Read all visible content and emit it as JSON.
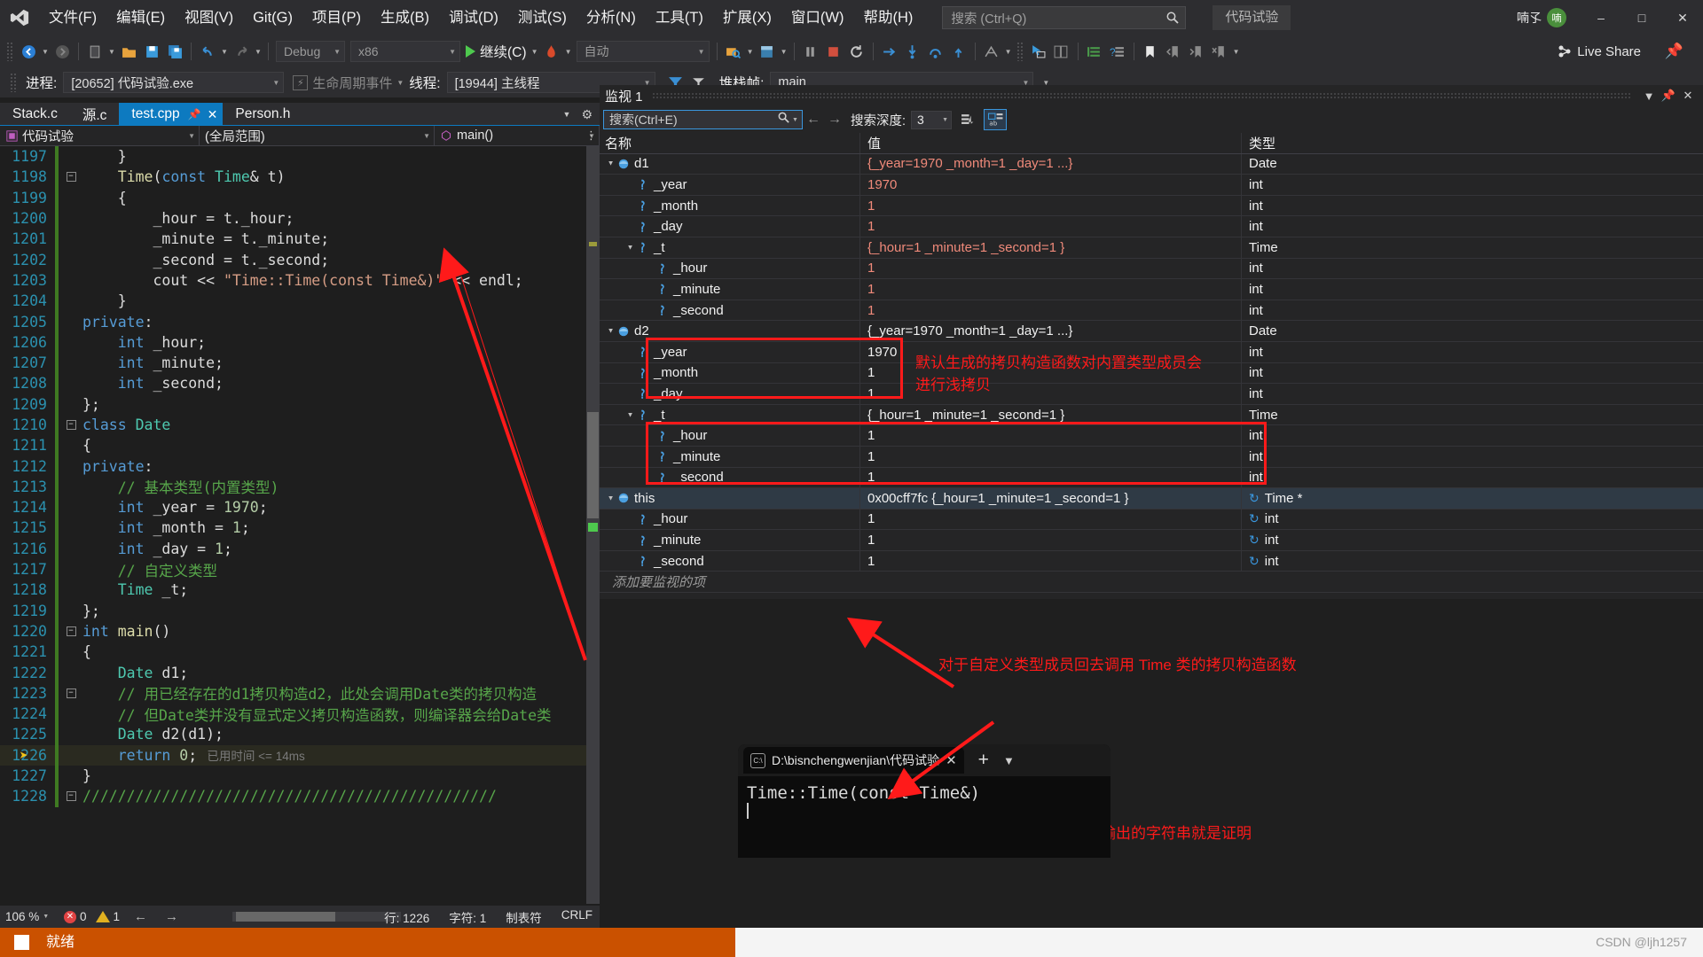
{
  "menu": {
    "items": [
      "文件(F)",
      "编辑(E)",
      "视图(V)",
      "Git(G)",
      "项目(P)",
      "生成(B)",
      "调试(D)",
      "测试(S)",
      "分析(N)",
      "工具(T)",
      "扩展(X)",
      "窗口(W)",
      "帮助(H)"
    ],
    "search_placeholder": "搜索 (Ctrl+Q)",
    "project_chip": "代码试验",
    "account_name": "喃孓",
    "account_initial": "喃"
  },
  "toolbar": {
    "config": "Debug",
    "platform": "x86",
    "run_label": "继续(C)",
    "auto": "自动",
    "live_share": "Live Share"
  },
  "debugbar": {
    "process_label": "进程:",
    "process_value": "[20652] 代码试验.exe",
    "lifecycle": "生命周期事件",
    "thread_label": "线程:",
    "thread_value": "[19944] 主线程",
    "stackframe_label": "堆栈帧:",
    "stackframe_value": "main"
  },
  "editor": {
    "tabs": [
      {
        "label": "Stack.c",
        "active": false
      },
      {
        "label": "源.c",
        "active": false
      },
      {
        "label": "test.cpp",
        "active": true
      },
      {
        "label": "Person.h",
        "active": false
      }
    ],
    "nav": {
      "project": "代码试验",
      "scope": "(全局范围)",
      "member": "main()"
    },
    "lines": [
      {
        "n": "1197",
        "fold": "",
        "cur": false,
        "tokens": [
          {
            "t": "    }",
            "c": "c-pun"
          }
        ]
      },
      {
        "n": "1198",
        "fold": "-",
        "cur": false,
        "tokens": [
          {
            "t": "    ",
            "c": "c-pun"
          },
          {
            "t": "Time",
            "c": "c-fn"
          },
          {
            "t": "(",
            "c": "c-pun"
          },
          {
            "t": "const",
            "c": "c-kw"
          },
          {
            "t": " ",
            "c": "c-pun"
          },
          {
            "t": "Time",
            "c": "c-type"
          },
          {
            "t": "& t)",
            "c": "c-pun"
          }
        ]
      },
      {
        "n": "1199",
        "fold": "",
        "cur": false,
        "tokens": [
          {
            "t": "    {",
            "c": "c-pun"
          }
        ]
      },
      {
        "n": "1200",
        "fold": "",
        "cur": false,
        "tokens": [
          {
            "t": "        _hour = t._hour;",
            "c": "c-pun"
          }
        ]
      },
      {
        "n": "1201",
        "fold": "",
        "cur": false,
        "tokens": [
          {
            "t": "        _minute = t._minute;",
            "c": "c-pun"
          }
        ]
      },
      {
        "n": "1202",
        "fold": "",
        "cur": false,
        "tokens": [
          {
            "t": "        _second = t._second;",
            "c": "c-pun"
          }
        ]
      },
      {
        "n": "1203",
        "fold": "",
        "cur": false,
        "tokens": [
          {
            "t": "        cout << ",
            "c": "c-pun"
          },
          {
            "t": "\"Time::Time(const Time&)\"",
            "c": "c-str"
          },
          {
            "t": " << endl;",
            "c": "c-pun"
          }
        ]
      },
      {
        "n": "1204",
        "fold": "",
        "cur": false,
        "tokens": [
          {
            "t": "    }",
            "c": "c-pun"
          }
        ]
      },
      {
        "n": "1205",
        "fold": "",
        "cur": false,
        "tokens": [
          {
            "t": "private",
            "c": "c-kw"
          },
          {
            "t": ":",
            "c": "c-pun"
          }
        ]
      },
      {
        "n": "1206",
        "fold": "",
        "cur": false,
        "tokens": [
          {
            "t": "    ",
            "c": "c-pun"
          },
          {
            "t": "int",
            "c": "c-kw"
          },
          {
            "t": " _hour;",
            "c": "c-pun"
          }
        ]
      },
      {
        "n": "1207",
        "fold": "",
        "cur": false,
        "tokens": [
          {
            "t": "    ",
            "c": "c-pun"
          },
          {
            "t": "int",
            "c": "c-kw"
          },
          {
            "t": " _minute;",
            "c": "c-pun"
          }
        ]
      },
      {
        "n": "1208",
        "fold": "",
        "cur": false,
        "tokens": [
          {
            "t": "    ",
            "c": "c-pun"
          },
          {
            "t": "int",
            "c": "c-kw"
          },
          {
            "t": " _second;",
            "c": "c-pun"
          }
        ]
      },
      {
        "n": "1209",
        "fold": "",
        "cur": false,
        "tokens": [
          {
            "t": "};",
            "c": "c-pun"
          }
        ]
      },
      {
        "n": "1210",
        "fold": "-",
        "cur": false,
        "tokens": [
          {
            "t": "class",
            "c": "c-kw"
          },
          {
            "t": " ",
            "c": "c-pun"
          },
          {
            "t": "Date",
            "c": "c-type"
          }
        ]
      },
      {
        "n": "1211",
        "fold": "",
        "cur": false,
        "tokens": [
          {
            "t": "{",
            "c": "c-pun"
          }
        ]
      },
      {
        "n": "1212",
        "fold": "",
        "cur": false,
        "tokens": [
          {
            "t": "private",
            "c": "c-kw"
          },
          {
            "t": ":",
            "c": "c-pun"
          }
        ]
      },
      {
        "n": "1213",
        "fold": "",
        "cur": false,
        "tokens": [
          {
            "t": "    // 基本类型(内置类型)",
            "c": "c-com"
          }
        ]
      },
      {
        "n": "1214",
        "fold": "",
        "cur": false,
        "tokens": [
          {
            "t": "    ",
            "c": "c-pun"
          },
          {
            "t": "int",
            "c": "c-kw"
          },
          {
            "t": " _year = ",
            "c": "c-pun"
          },
          {
            "t": "1970",
            "c": "c-num"
          },
          {
            "t": ";",
            "c": "c-pun"
          }
        ]
      },
      {
        "n": "1215",
        "fold": "",
        "cur": false,
        "tokens": [
          {
            "t": "    ",
            "c": "c-pun"
          },
          {
            "t": "int",
            "c": "c-kw"
          },
          {
            "t": " _month = ",
            "c": "c-pun"
          },
          {
            "t": "1",
            "c": "c-num"
          },
          {
            "t": ";",
            "c": "c-pun"
          }
        ]
      },
      {
        "n": "1216",
        "fold": "",
        "cur": false,
        "tokens": [
          {
            "t": "    ",
            "c": "c-pun"
          },
          {
            "t": "int",
            "c": "c-kw"
          },
          {
            "t": " _day = ",
            "c": "c-pun"
          },
          {
            "t": "1",
            "c": "c-num"
          },
          {
            "t": ";",
            "c": "c-pun"
          }
        ]
      },
      {
        "n": "1217",
        "fold": "",
        "cur": false,
        "tokens": [
          {
            "t": "    // 自定义类型",
            "c": "c-com"
          }
        ]
      },
      {
        "n": "1218",
        "fold": "",
        "cur": false,
        "tokens": [
          {
            "t": "    ",
            "c": "c-pun"
          },
          {
            "t": "Time",
            "c": "c-type"
          },
          {
            "t": " _t;",
            "c": "c-pun"
          }
        ]
      },
      {
        "n": "1219",
        "fold": "",
        "cur": false,
        "tokens": [
          {
            "t": "};",
            "c": "c-pun"
          }
        ]
      },
      {
        "n": "1220",
        "fold": "-",
        "cur": false,
        "tokens": [
          {
            "t": "int",
            "c": "c-kw"
          },
          {
            "t": " ",
            "c": "c-pun"
          },
          {
            "t": "main",
            "c": "c-fn"
          },
          {
            "t": "()",
            "c": "c-pun"
          }
        ]
      },
      {
        "n": "1221",
        "fold": "",
        "cur": false,
        "tokens": [
          {
            "t": "{",
            "c": "c-pun"
          }
        ]
      },
      {
        "n": "1222",
        "fold": "",
        "cur": false,
        "tokens": [
          {
            "t": "    ",
            "c": "c-pun"
          },
          {
            "t": "Date",
            "c": "c-type"
          },
          {
            "t": " d1;",
            "c": "c-pun"
          }
        ]
      },
      {
        "n": "1223",
        "fold": "-",
        "cur": false,
        "tokens": [
          {
            "t": "    // 用已经存在的d1拷贝构造d2，此处会调用Date类的拷贝构造",
            "c": "c-com"
          }
        ]
      },
      {
        "n": "1224",
        "fold": "",
        "cur": false,
        "tokens": [
          {
            "t": "    // 但Date类并没有显式定义拷贝构造函数，则编译器会给Date类",
            "c": "c-com"
          }
        ]
      },
      {
        "n": "1225",
        "fold": "",
        "cur": false,
        "tokens": [
          {
            "t": "    ",
            "c": "c-pun"
          },
          {
            "t": "Date",
            "c": "c-type"
          },
          {
            "t": " d2(d1);",
            "c": "c-pun"
          }
        ]
      },
      {
        "n": "1226",
        "fold": "",
        "cur": true,
        "tokens": [
          {
            "t": "    ",
            "c": "c-pun"
          },
          {
            "t": "return",
            "c": "c-kw"
          },
          {
            "t": " ",
            "c": "c-pun"
          },
          {
            "t": "0",
            "c": "c-num"
          },
          {
            "t": ";",
            "c": "c-pun"
          },
          {
            "t": "   已用时间 <= 14ms",
            "c": "c-hint"
          }
        ]
      },
      {
        "n": "1227",
        "fold": "",
        "cur": false,
        "tokens": [
          {
            "t": "}",
            "c": "c-pun"
          }
        ]
      },
      {
        "n": "1228",
        "fold": "-",
        "cur": false,
        "tokens": [
          {
            "t": "///////////////////////////////////////////////",
            "c": "c-com"
          }
        ]
      }
    ],
    "status": {
      "zoom": "106 %",
      "errors": "0",
      "warnings": "1",
      "line": "行: 1226",
      "col": "字符: 1",
      "tab": "制表符",
      "eol": "CRLF"
    }
  },
  "watch": {
    "title": "监视 1",
    "search_placeholder": "搜索(Ctrl+E)",
    "depth_label": "搜索深度:",
    "depth_value": "3",
    "columns": [
      "名称",
      "值",
      "类型"
    ],
    "add_watch_placeholder": "添加要监视的项",
    "rows": [
      {
        "indent": 0,
        "exp": "▲",
        "icon": "obj",
        "name": "d1",
        "value": "{_year=1970 _month=1 _day=1 ...}",
        "vstyle": "red",
        "type": "Date",
        "refresh": false,
        "sel": false
      },
      {
        "indent": 1,
        "exp": "",
        "icon": "field",
        "name": "_year",
        "value": "1970",
        "vstyle": "red",
        "type": "int",
        "refresh": false,
        "sel": false
      },
      {
        "indent": 1,
        "exp": "",
        "icon": "field",
        "name": "_month",
        "value": "1",
        "vstyle": "red",
        "type": "int",
        "refresh": false,
        "sel": false
      },
      {
        "indent": 1,
        "exp": "",
        "icon": "field",
        "name": "_day",
        "value": "1",
        "vstyle": "red",
        "type": "int",
        "refresh": false,
        "sel": false
      },
      {
        "indent": 1,
        "exp": "▲",
        "icon": "field",
        "name": "_t",
        "value": "{_hour=1 _minute=1 _second=1 }",
        "vstyle": "red",
        "type": "Time",
        "refresh": false,
        "sel": false
      },
      {
        "indent": 2,
        "exp": "",
        "icon": "field",
        "name": "_hour",
        "value": "1",
        "vstyle": "red",
        "type": "int",
        "refresh": false,
        "sel": false
      },
      {
        "indent": 2,
        "exp": "",
        "icon": "field",
        "name": "_minute",
        "value": "1",
        "vstyle": "red",
        "type": "int",
        "refresh": false,
        "sel": false
      },
      {
        "indent": 2,
        "exp": "",
        "icon": "field",
        "name": "_second",
        "value": "1",
        "vstyle": "red",
        "type": "int",
        "refresh": false,
        "sel": false
      },
      {
        "indent": 0,
        "exp": "▲",
        "icon": "obj",
        "name": "d2",
        "value": "{_year=1970 _month=1 _day=1 ...}",
        "vstyle": "white",
        "type": "Date",
        "refresh": false,
        "sel": false
      },
      {
        "indent": 1,
        "exp": "",
        "icon": "field",
        "name": "_year",
        "value": "1970",
        "vstyle": "white",
        "type": "int",
        "refresh": false,
        "sel": false
      },
      {
        "indent": 1,
        "exp": "",
        "icon": "field",
        "name": "_month",
        "value": "1",
        "vstyle": "white",
        "type": "int",
        "refresh": false,
        "sel": false
      },
      {
        "indent": 1,
        "exp": "",
        "icon": "field",
        "name": "_day",
        "value": "1",
        "vstyle": "white",
        "type": "int",
        "refresh": false,
        "sel": false
      },
      {
        "indent": 1,
        "exp": "▲",
        "icon": "field",
        "name": "_t",
        "value": "{_hour=1 _minute=1 _second=1 }",
        "vstyle": "white",
        "type": "Time",
        "refresh": false,
        "sel": false
      },
      {
        "indent": 2,
        "exp": "",
        "icon": "field",
        "name": "_hour",
        "value": "1",
        "vstyle": "white",
        "type": "int",
        "refresh": false,
        "sel": false
      },
      {
        "indent": 2,
        "exp": "",
        "icon": "field",
        "name": "_minute",
        "value": "1",
        "vstyle": "white",
        "type": "int",
        "refresh": false,
        "sel": false
      },
      {
        "indent": 2,
        "exp": "",
        "icon": "field",
        "name": "_second",
        "value": "1",
        "vstyle": "white",
        "type": "int",
        "refresh": false,
        "sel": false
      },
      {
        "indent": 0,
        "exp": "▲",
        "icon": "obj",
        "name": "this",
        "value": "0x00cff7fc {_hour=1 _minute=1 _second=1 }",
        "vstyle": "white",
        "type": "Time *",
        "refresh": true,
        "sel": true
      },
      {
        "indent": 1,
        "exp": "",
        "icon": "field",
        "name": "_hour",
        "value": "1",
        "vstyle": "white",
        "type": "int",
        "refresh": true,
        "sel": false
      },
      {
        "indent": 1,
        "exp": "",
        "icon": "field",
        "name": "_minute",
        "value": "1",
        "vstyle": "white",
        "type": "int",
        "refresh": true,
        "sel": false
      },
      {
        "indent": 1,
        "exp": "",
        "icon": "field",
        "name": "_second",
        "value": "1",
        "vstyle": "white",
        "type": "int",
        "refresh": true,
        "sel": false
      }
    ]
  },
  "annotations": {
    "note1": "默认生成的拷贝构造函数对内置类型成员会\n进行浅拷贝",
    "note2": "对于自定义类型成员回去调用 Time 类的拷贝构造函数",
    "note3": "控制台输出的字符串就是证明"
  },
  "console": {
    "tab_title": "D:\\bisnchengwenjian\\代码试验",
    "output": "Time::Time(const Time&)"
  },
  "statusbar": {
    "ready": "就绪",
    "watermark": "CSDN @ljh1257"
  },
  "colors": {
    "accent": "#0d7ac0",
    "annotation_red": "#ff1a1a",
    "status_orange": "#ca5100",
    "value_red": "#f08a7a"
  }
}
